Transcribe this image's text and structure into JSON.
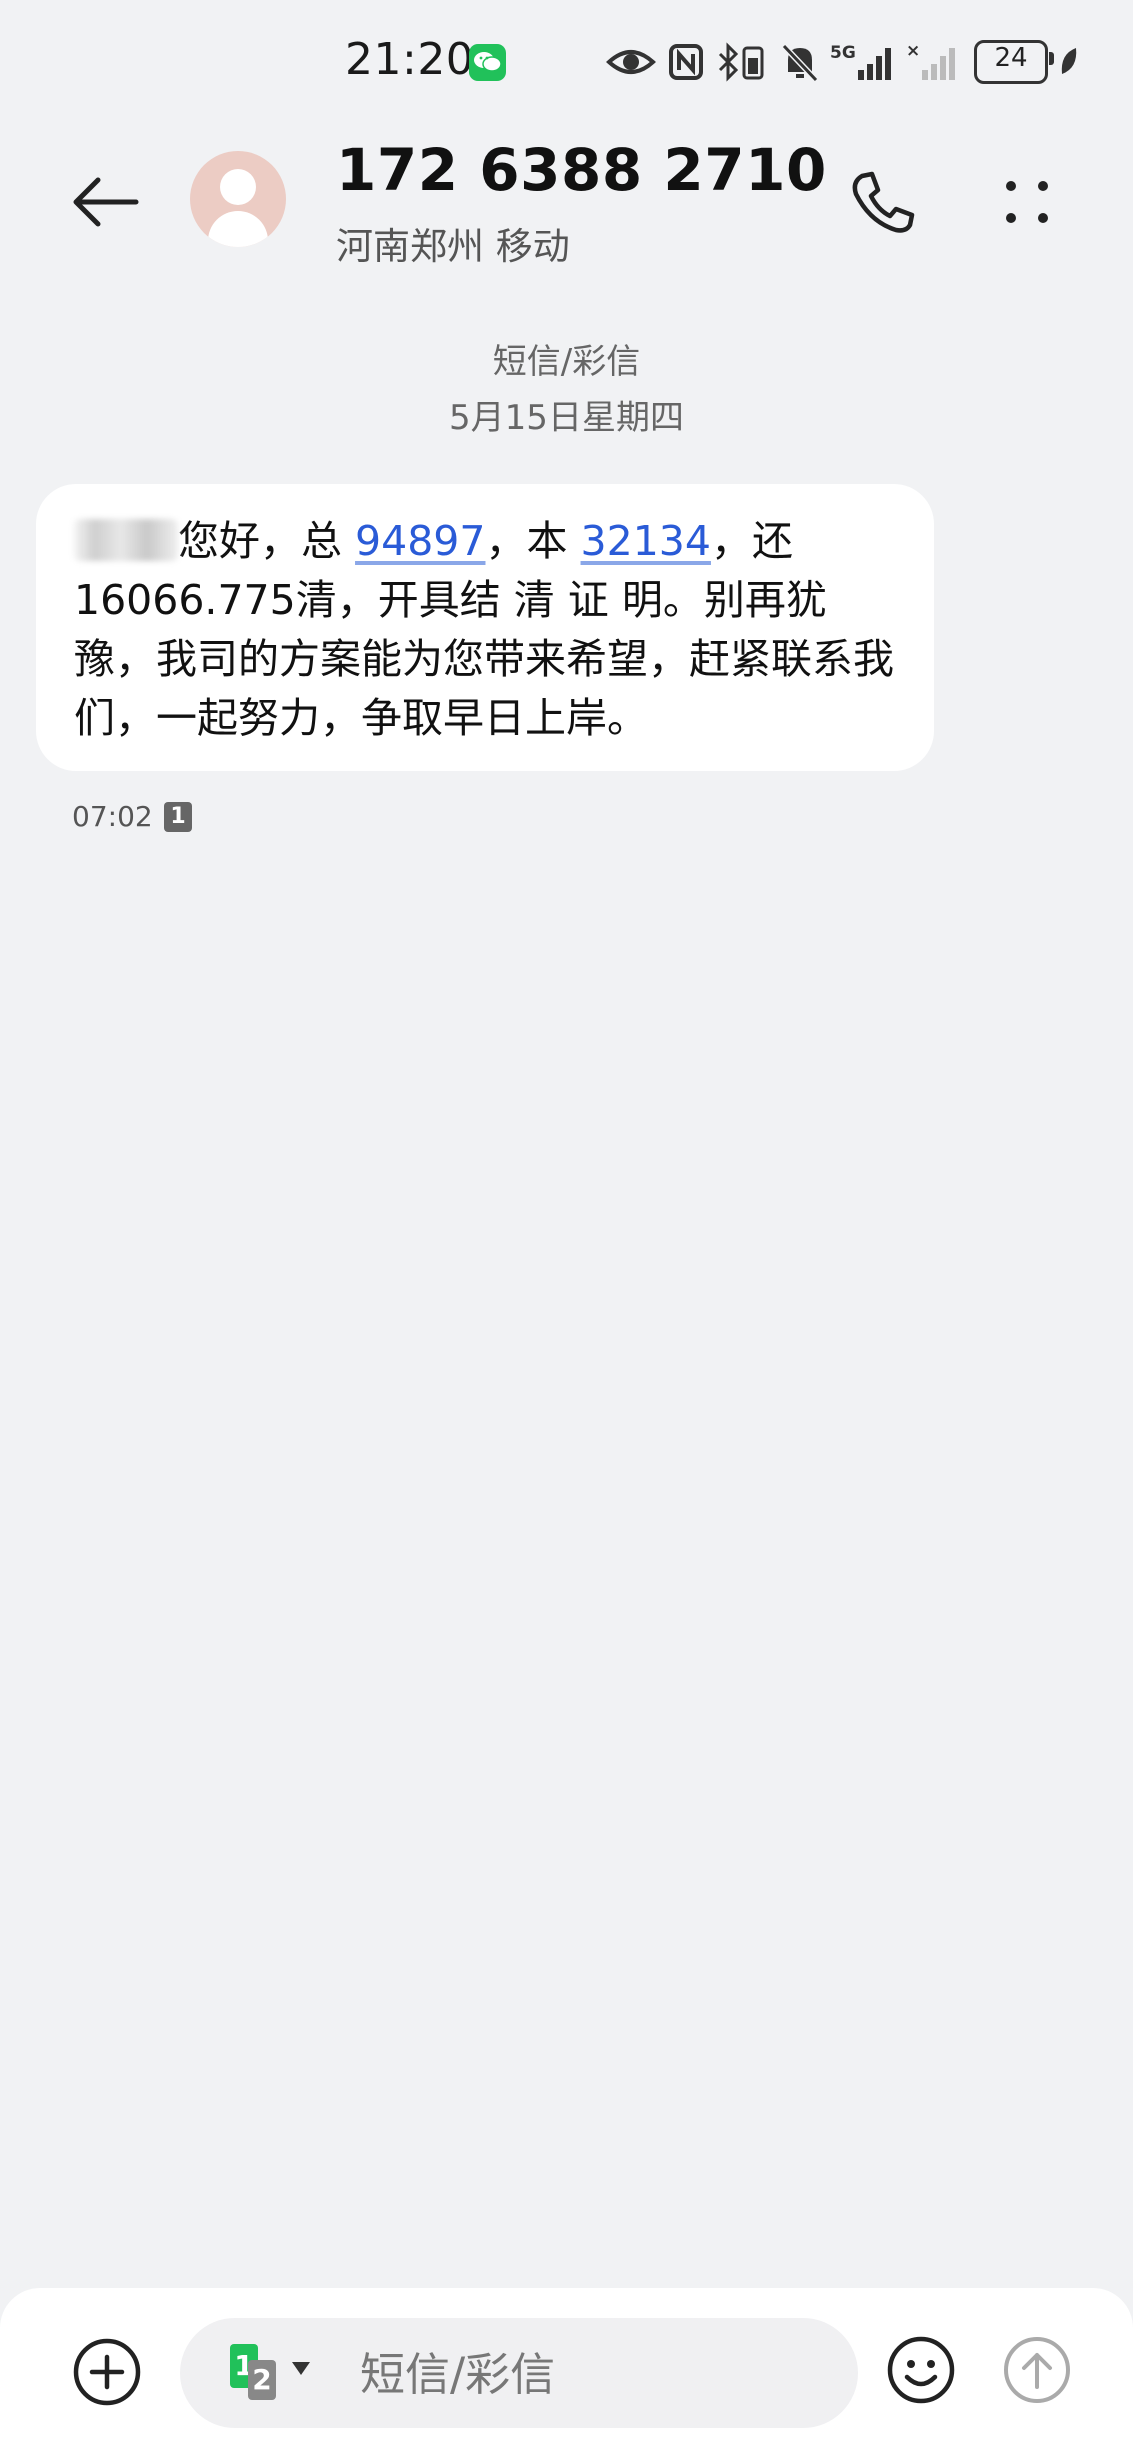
{
  "status_bar": {
    "time": "21:20",
    "network": "5G",
    "battery": "24",
    "icons": [
      "wechat-icon",
      "eye-icon",
      "nfc-icon",
      "bluetooth-battery-icon",
      "mute-bell-icon",
      "signal-5g-icon",
      "signal-sim2-icon",
      "battery-icon",
      "leaf-icon"
    ]
  },
  "header": {
    "phone_number": "172 6388 2710",
    "location": "河南郑州 移动",
    "icons": [
      "back-arrow-icon",
      "avatar-icon",
      "phone-icon",
      "more-dots-icon"
    ]
  },
  "thread": {
    "channel_label": "短信/彩信",
    "date_label": "5月15日星期四",
    "message": {
      "text_a": "您好，总 ",
      "link_total": "94897",
      "text_b": "，本 ",
      "link_principal": "32134",
      "text_c": "，还 16066.775清，开具结 清 证 明。别再犹豫，我司的方案能为您带来希望，赶紧联系我们，一起努力，争取早日上岸。",
      "time": "07:02",
      "sim_slot": "1"
    }
  },
  "compose": {
    "placeholder": "短信/彩信",
    "sim_primary": "1",
    "sim_secondary": "2",
    "icons": [
      "add-icon",
      "emoji-icon",
      "send-arrow-icon",
      "dropdown-caret-icon"
    ]
  },
  "colors": {
    "background": "#f1f2f4",
    "bubble": "#ffffff",
    "link": "#2a5bd7",
    "sim_green": "#21c15a",
    "avatar": "#ecccc4"
  }
}
